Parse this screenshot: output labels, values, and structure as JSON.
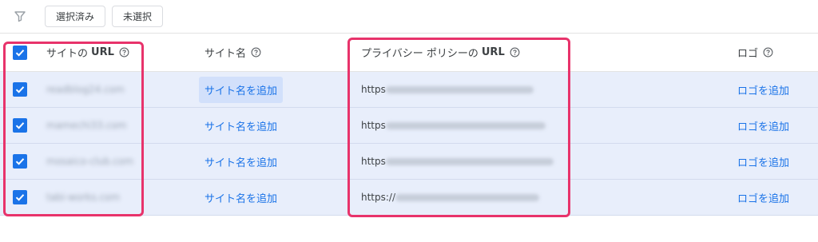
{
  "toolbar": {
    "filter_icon": "filter-icon",
    "selected_label": "選択済み",
    "unselected_label": "未選択"
  },
  "header": {
    "url_prefix": "サイトの",
    "url_bold": "URL",
    "site_name": "サイト名",
    "policy_prefix": "プライバシー ポリシーの",
    "policy_bold": "URL",
    "logo": "ロゴ",
    "help_icon": "help-circle-icon"
  },
  "rows": [
    {
      "site_url": "readblog24.com",
      "add_name": "サイト名を追加",
      "policy_prefix": "https",
      "add_logo": "ロゴを追加",
      "checked": true
    },
    {
      "site_url": "mamechi33.com",
      "add_name": "サイト名を追加",
      "policy_prefix": "https",
      "add_logo": "ロゴを追加",
      "checked": true
    },
    {
      "site_url": "mosaico-club.com",
      "add_name": "サイト名を追加",
      "policy_prefix": "https",
      "add_logo": "ロゴを追加",
      "checked": true
    },
    {
      "site_url": "tabi-works.com",
      "add_name": "サイト名を追加",
      "policy_prefix": "https://",
      "add_logo": "ロゴを追加",
      "checked": true
    }
  ],
  "colors": {
    "accent": "#1a73e8",
    "selected_row_bg": "#e8eefb",
    "highlight": "#e8336b"
  }
}
